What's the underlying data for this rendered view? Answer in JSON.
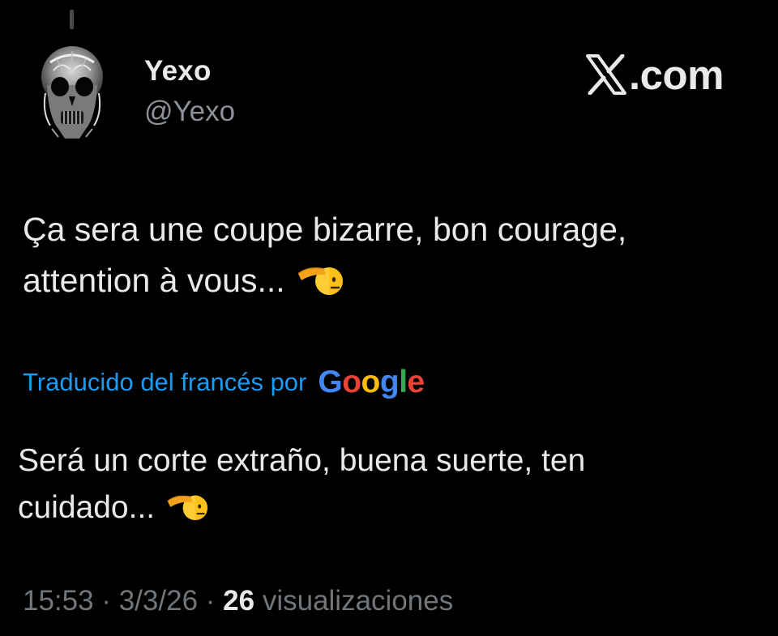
{
  "author": {
    "display_name": "Yexo",
    "handle": "@Yexo",
    "avatar_icon": "skull-avatar"
  },
  "brand": {
    "logo_icon": "x-logo-icon",
    "text": ".com"
  },
  "tweet": {
    "text_line1": "Ça sera une coupe bizarre, bon courage,",
    "text_line2": "attention à vous...",
    "emoji": "saluting-face-emoji"
  },
  "translation": {
    "label": "Traducido del francés por",
    "provider": "Google",
    "text_line1": "Será un corte extraño, buena suerte, ten",
    "text_line2": "cuidado...",
    "emoji": "saluting-face-emoji"
  },
  "meta": {
    "time": "15:53",
    "separator": "·",
    "date": "3/3/26",
    "views_count": "26",
    "views_label": "visualizaciones"
  },
  "colors": {
    "background": "#000000",
    "text": "#e7e9ea",
    "secondary_text": "#71767b",
    "link": "#1d9bf0"
  }
}
